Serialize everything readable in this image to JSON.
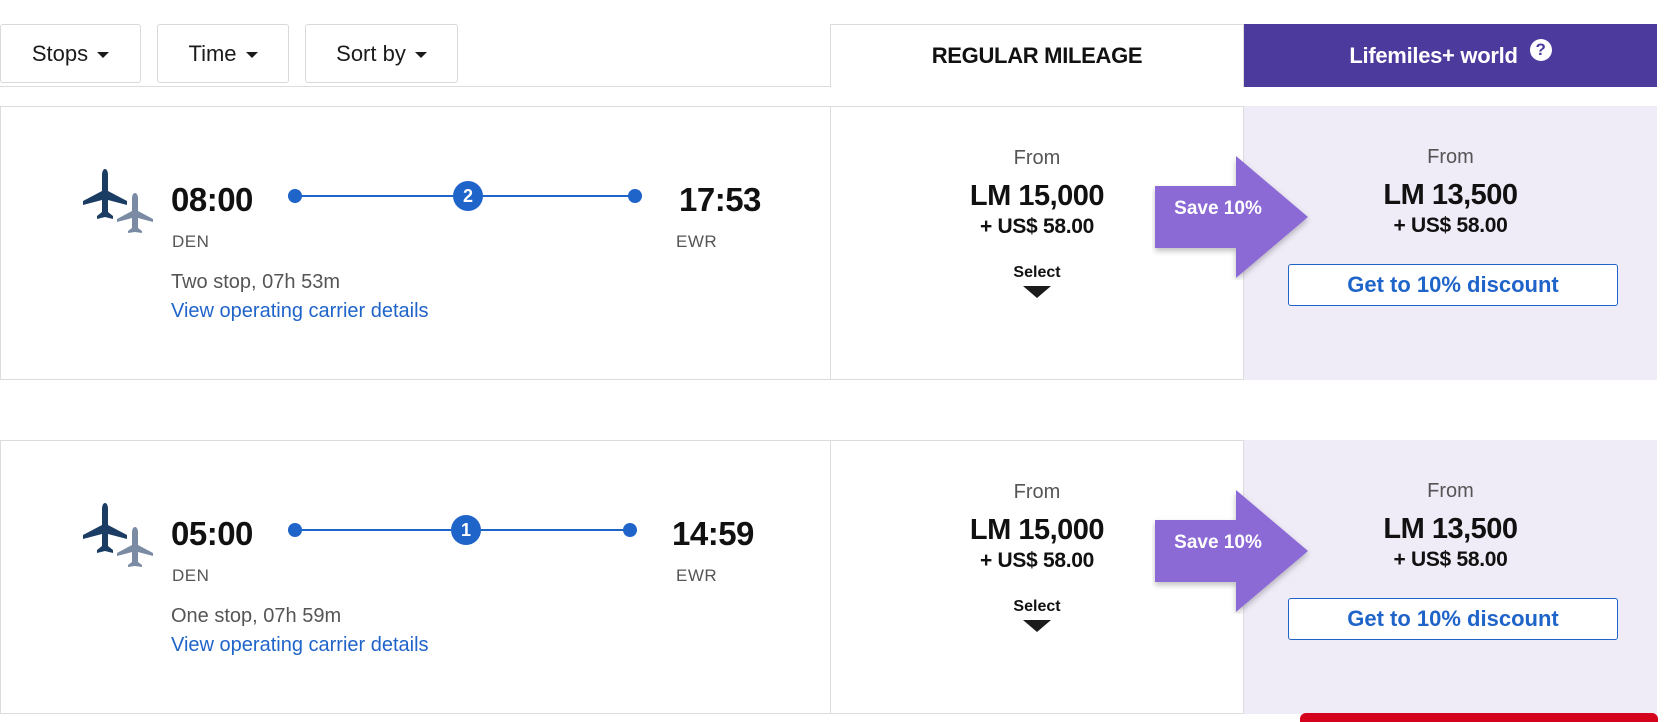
{
  "filters": {
    "stops": "Stops",
    "time": "Time",
    "sort": "Sort by"
  },
  "headers": {
    "regular": "REGULAR MILEAGE",
    "plus": "Lifemiles+ world",
    "help_icon": "?"
  },
  "colors": {
    "accent_purple": "#4d3a9d",
    "save_purple": "#8b6ad6",
    "link_blue": "#1f64c9",
    "plus_bg": "#efebf7",
    "alert_red": "#d4021d"
  },
  "icons": [
    "plane-icon",
    "chevron-down-icon",
    "help-icon",
    "save-arrow-icon"
  ],
  "flights": [
    {
      "dep_time": "08:00",
      "dep_code": "DEN",
      "arr_time": "17:53",
      "arr_code": "EWR",
      "stops": "2",
      "duration": "Two stop, 07h 53m",
      "carrier_link": "View operating carrier details",
      "regular": {
        "from": "From",
        "miles": "LM 15,000",
        "fees": "+ US$ 58.00",
        "select": "Select"
      },
      "save": "Save 10%",
      "plus": {
        "from": "From",
        "miles": "LM 13,500",
        "fees": "+ US$ 58.00",
        "discount": "Get to 10% discount"
      }
    },
    {
      "dep_time": "05:00",
      "dep_code": "DEN",
      "arr_time": "14:59",
      "arr_code": "EWR",
      "stops": "1",
      "duration": "One stop, 07h 59m",
      "carrier_link": "View operating carrier details",
      "regular": {
        "from": "From",
        "miles": "LM 15,000",
        "fees": "+ US$ 58.00",
        "select": "Select"
      },
      "save": "Save 10%",
      "plus": {
        "from": "From",
        "miles": "LM 13,500",
        "fees": "+ US$ 58.00",
        "discount": "Get to 10% discount"
      }
    }
  ]
}
